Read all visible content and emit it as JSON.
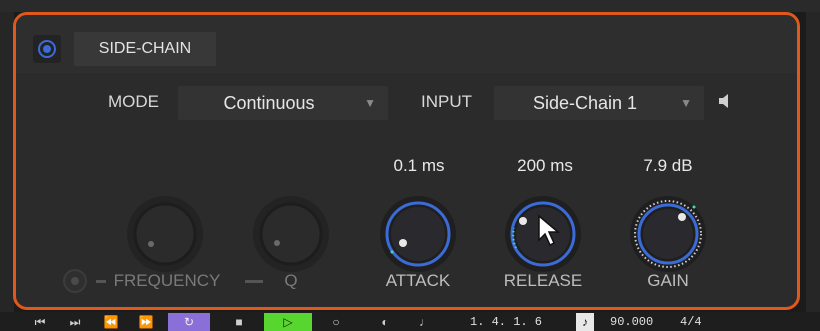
{
  "panel": {
    "tab_label": "SIDE-CHAIN",
    "mode_label": "MODE",
    "mode_value": "Continuous",
    "input_label": "INPUT",
    "input_value": "Side-Chain 1"
  },
  "knobs": {
    "frequency": {
      "label": "FREQUENCY",
      "enabled": false
    },
    "q": {
      "label": "Q",
      "enabled": false
    },
    "attack": {
      "label": "ATTACK",
      "value": "0.1 ms"
    },
    "release": {
      "label": "RELEASE",
      "value": "200 ms"
    },
    "gain": {
      "label": "GAIN",
      "value": "7.9 dB"
    }
  },
  "transport": {
    "position": "1. 4. 1. 6",
    "tempo": "90.000",
    "meter": "4/4"
  },
  "colors": {
    "accent_border": "#e0581c",
    "knob_ring": "#3a6bd6",
    "loop": "#8a6fd8",
    "play": "#58d630"
  },
  "icons": [
    "power-icon",
    "dropdown-arrow-icon",
    "speaker-icon",
    "cursor-icon",
    "rewind-icon",
    "fast-forward-icon",
    "stop-icon",
    "play-icon",
    "record-icon",
    "loop-icon",
    "metronome-icon"
  ]
}
